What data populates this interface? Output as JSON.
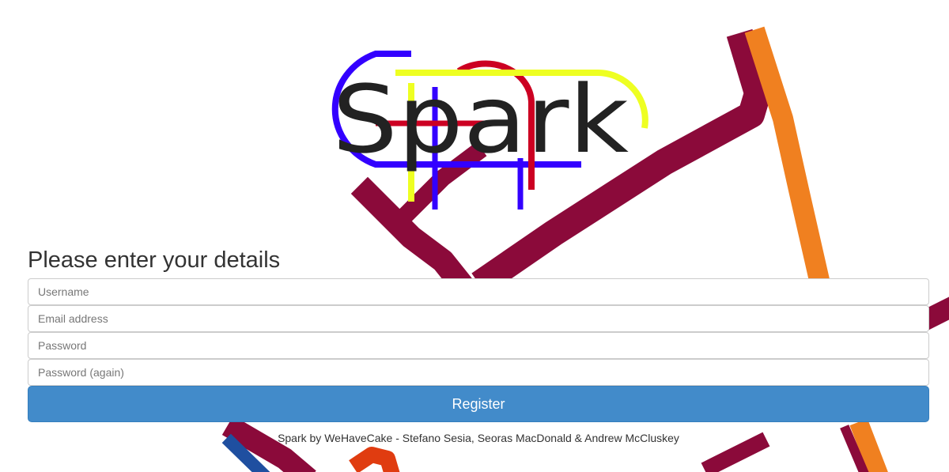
{
  "logo": {
    "text": "Spark"
  },
  "form": {
    "heading": "Please enter your details",
    "username_placeholder": "Username",
    "email_placeholder": "Email address",
    "password_placeholder": "Password",
    "password_again_placeholder": "Password (again)",
    "register_label": "Register"
  },
  "footer": {
    "text": "Spark by WeHaveCake - Stefano Sesia, Seoras MacDonald & Andrew McCluskey"
  },
  "colors": {
    "primary_button": "#428bca",
    "route_maroon": "#8b0a3a",
    "route_orange": "#f08020",
    "logo_blue": "#3300ff",
    "logo_red": "#cc0022",
    "logo_yellow": "#eeff22",
    "logo_text": "#222222"
  }
}
